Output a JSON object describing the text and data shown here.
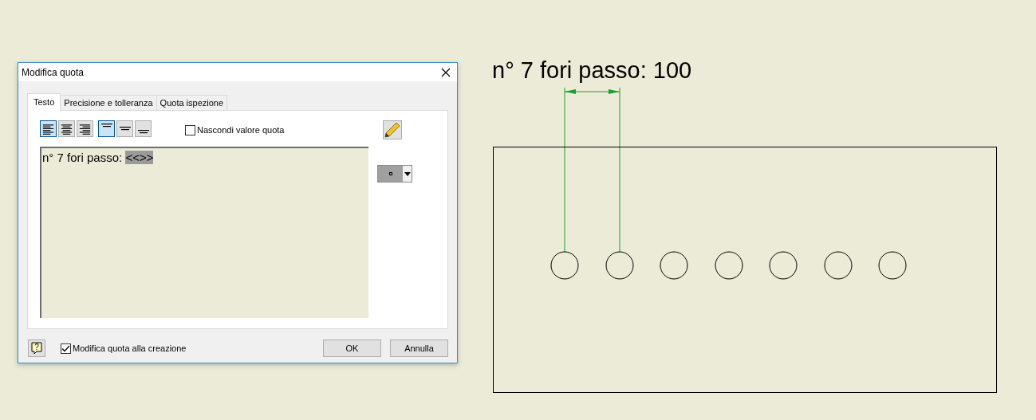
{
  "dialog": {
    "title": "Modifica quota",
    "tabs": [
      {
        "label": "Testo",
        "selected": true
      },
      {
        "label": "Precisione e tolleranza",
        "selected": false
      },
      {
        "label": "Quota ispezione",
        "selected": false
      }
    ],
    "horizontal_alignment": [
      {
        "selected": true
      },
      {
        "selected": false
      },
      {
        "selected": false
      }
    ],
    "vertical_alignment": [
      {
        "selected": true
      },
      {
        "selected": false
      },
      {
        "selected": false
      }
    ],
    "hide_value": {
      "label": "Nascondi valore quota",
      "checked": false
    },
    "editor": {
      "text": "n° 7 fori passo: ",
      "selected_text": "<<>>"
    },
    "edit_on_create": {
      "label": "Modifica quota alla creazione",
      "checked": true
    },
    "help_button": "?",
    "buttons": [
      "OK",
      "Annulla"
    ]
  },
  "drawing": {
    "dimension_text": "n° 7 fori passo: 100"
  }
}
